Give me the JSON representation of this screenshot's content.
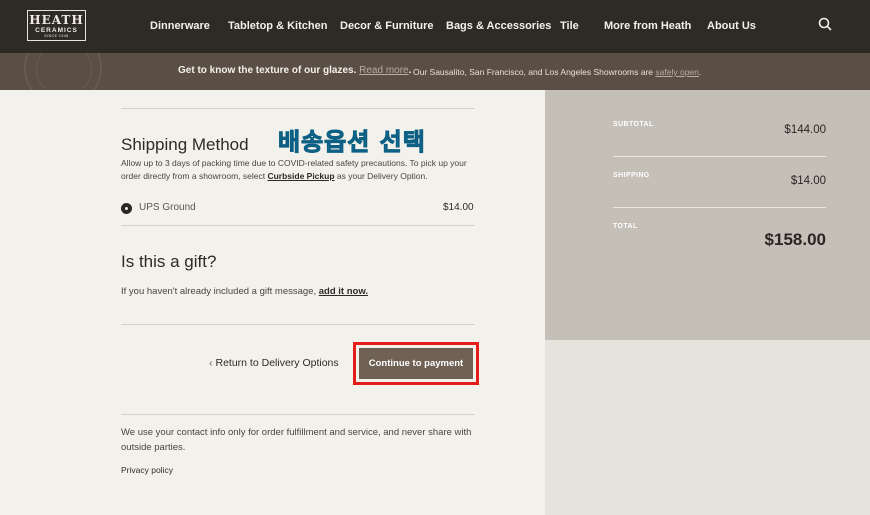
{
  "header": {
    "logo": {
      "line1": "HEATH",
      "line2": "CERAMICS",
      "line3": "SINCE 1948"
    },
    "nav": [
      "Dinnerware",
      "Tabletop & Kitchen",
      "Decor & Furniture",
      "Bags & Accessories",
      "Tile",
      "More from Heath",
      "About Us"
    ]
  },
  "promo": {
    "text1": "Get to know the texture of our glazes.",
    "link1": "Read more",
    "text2": "Our Sausalito, San Francisco, and Los Angeles Showrooms are",
    "link2": "safely open"
  },
  "shipping": {
    "title": "Shipping Method",
    "note_pre": "Allow up to 3 days of packing time due to COVID-related safety precautions. To pick up your order directly from a showroom, select",
    "note_link": "Curbside Pickup",
    "note_post": "as your Delivery Option.",
    "option_label": "UPS Ground",
    "option_price": "$14.00"
  },
  "overlay_label": "배송옵션 선택",
  "gift": {
    "title": "Is this a gift?",
    "text": "If you haven't already included a gift message,",
    "link": "add it now."
  },
  "actions": {
    "back": "Return to Delivery Options",
    "continue": "Continue to payment"
  },
  "footer": {
    "note": "We use your contact info only for order fulfillment and service, and never share with outside parties.",
    "privacy": "Privacy policy"
  },
  "summary": {
    "subtotal_label": "SUBTOTAL",
    "subtotal": "$144.00",
    "shipping_label": "SHIPPING",
    "shipping": "$14.00",
    "total_label": "TOTAL",
    "total": "$158.00"
  },
  "colors": {
    "header": "#2e2a26",
    "promo": "#5a4e45",
    "button": "#6f6154",
    "highlight": "#e41c1c"
  },
  "icons": {
    "search": "search-icon",
    "back": "chevron-left-icon",
    "radio": "radio-selected-icon"
  }
}
